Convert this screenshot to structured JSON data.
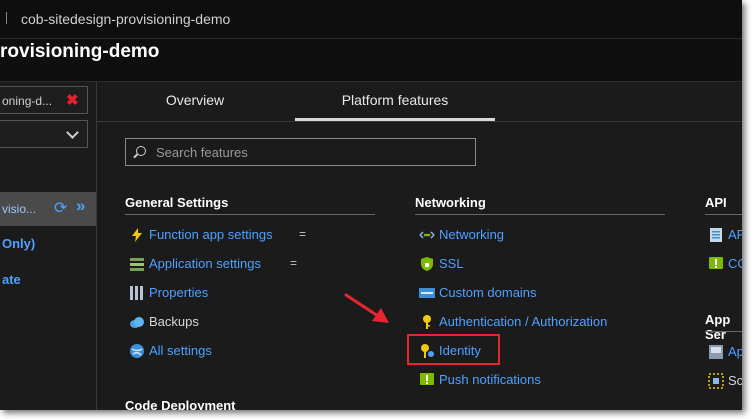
{
  "breadcrumb": {
    "text": "cob-sitedesign-provisioning-demo"
  },
  "page": {
    "title": "rovisioning-demo"
  },
  "left_panel": {
    "filter_text": "oning-d...",
    "selected_app": "visio...",
    "links": [
      "Only)",
      "ate"
    ]
  },
  "tabs": [
    {
      "label": "Overview"
    },
    {
      "label": "Platform features",
      "active": true
    }
  ],
  "search": {
    "placeholder": "Search features"
  },
  "sections": {
    "general_settings": {
      "title": "General Settings",
      "items": [
        {
          "label": "Function app settings",
          "icon": "lightning-icon",
          "gear": "="
        },
        {
          "label": "Application settings",
          "icon": "list-icon",
          "gear": "="
        },
        {
          "label": "Properties",
          "icon": "properties-icon"
        },
        {
          "label": "Backups",
          "icon": "cloud-icon"
        },
        {
          "label": "All settings",
          "icon": "globe-icon"
        }
      ]
    },
    "networking": {
      "title": "Networking",
      "items": [
        {
          "label": "Networking",
          "icon": "network-icon"
        },
        {
          "label": "SSL",
          "icon": "lock-icon"
        },
        {
          "label": "Custom domains",
          "icon": "domain-icon"
        },
        {
          "label": "Authentication / Authorization",
          "icon": "key-icon"
        },
        {
          "label": "Identity",
          "icon": "identity-key-icon",
          "highlighted": true
        },
        {
          "label": "Push notifications",
          "icon": "notification-icon"
        }
      ]
    },
    "api": {
      "title": "API",
      "items": [
        {
          "label": "API",
          "icon": "api-definition-icon"
        },
        {
          "label": "COR",
          "icon": "cors-icon"
        }
      ]
    },
    "app_service": {
      "title": "App Ser",
      "items": [
        {
          "label": "App",
          "icon": "app-service-plan-icon"
        },
        {
          "label": "Scal",
          "icon": "scale-icon"
        }
      ]
    },
    "code_deployment": {
      "title": "Code Deployment"
    }
  },
  "colors": {
    "link": "#4ea1ff",
    "highlight": "#e62530",
    "background": "#1b1b1b"
  }
}
